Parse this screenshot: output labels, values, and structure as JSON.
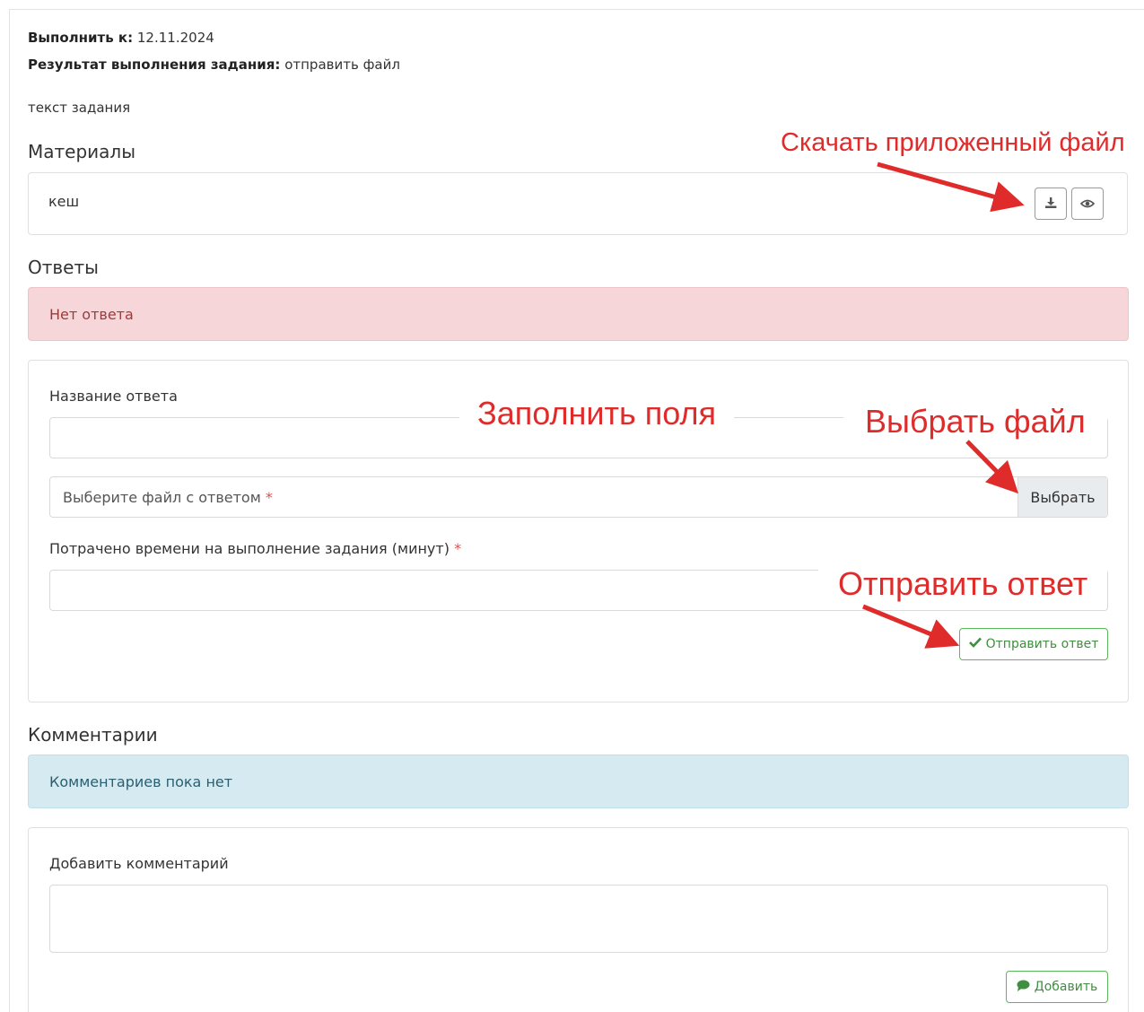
{
  "header": {
    "due_label": "Выполнить к:",
    "due_value": "12.11.2024",
    "result_label": "Результат выполнения задания:",
    "result_value": "отправить файл",
    "task_text": "текст задания"
  },
  "materials": {
    "title": "Материалы",
    "item_name": "кеш",
    "download_icon": "download-icon",
    "view_icon": "eye-icon"
  },
  "answers": {
    "title": "Ответы",
    "no_answer": "Нет ответа",
    "name_label": "Название ответа",
    "name_value": "",
    "file_placeholder": "Выберите файл с ответом",
    "required_mark": "*",
    "file_button": "Выбрать",
    "time_label": "Потрачено времени на выполнение задания (минут)",
    "time_value": "",
    "submit_label": "Отправить ответ"
  },
  "comments": {
    "title": "Комментарии",
    "empty": "Комментариев пока нет",
    "add_label": "Добавить комментарий",
    "comment_value": "",
    "add_button": "Добавить"
  },
  "annotations": {
    "download": "Скачать приложенный файл",
    "fill": "Заполнить поля",
    "choose": "Выбрать файл",
    "send": "Отправить ответ"
  },
  "colors": {
    "annotation_red": "#e02b2b",
    "success_green": "#5cb85c",
    "danger_bg": "#f6d6d8",
    "info_bg": "#d5ebf1"
  }
}
